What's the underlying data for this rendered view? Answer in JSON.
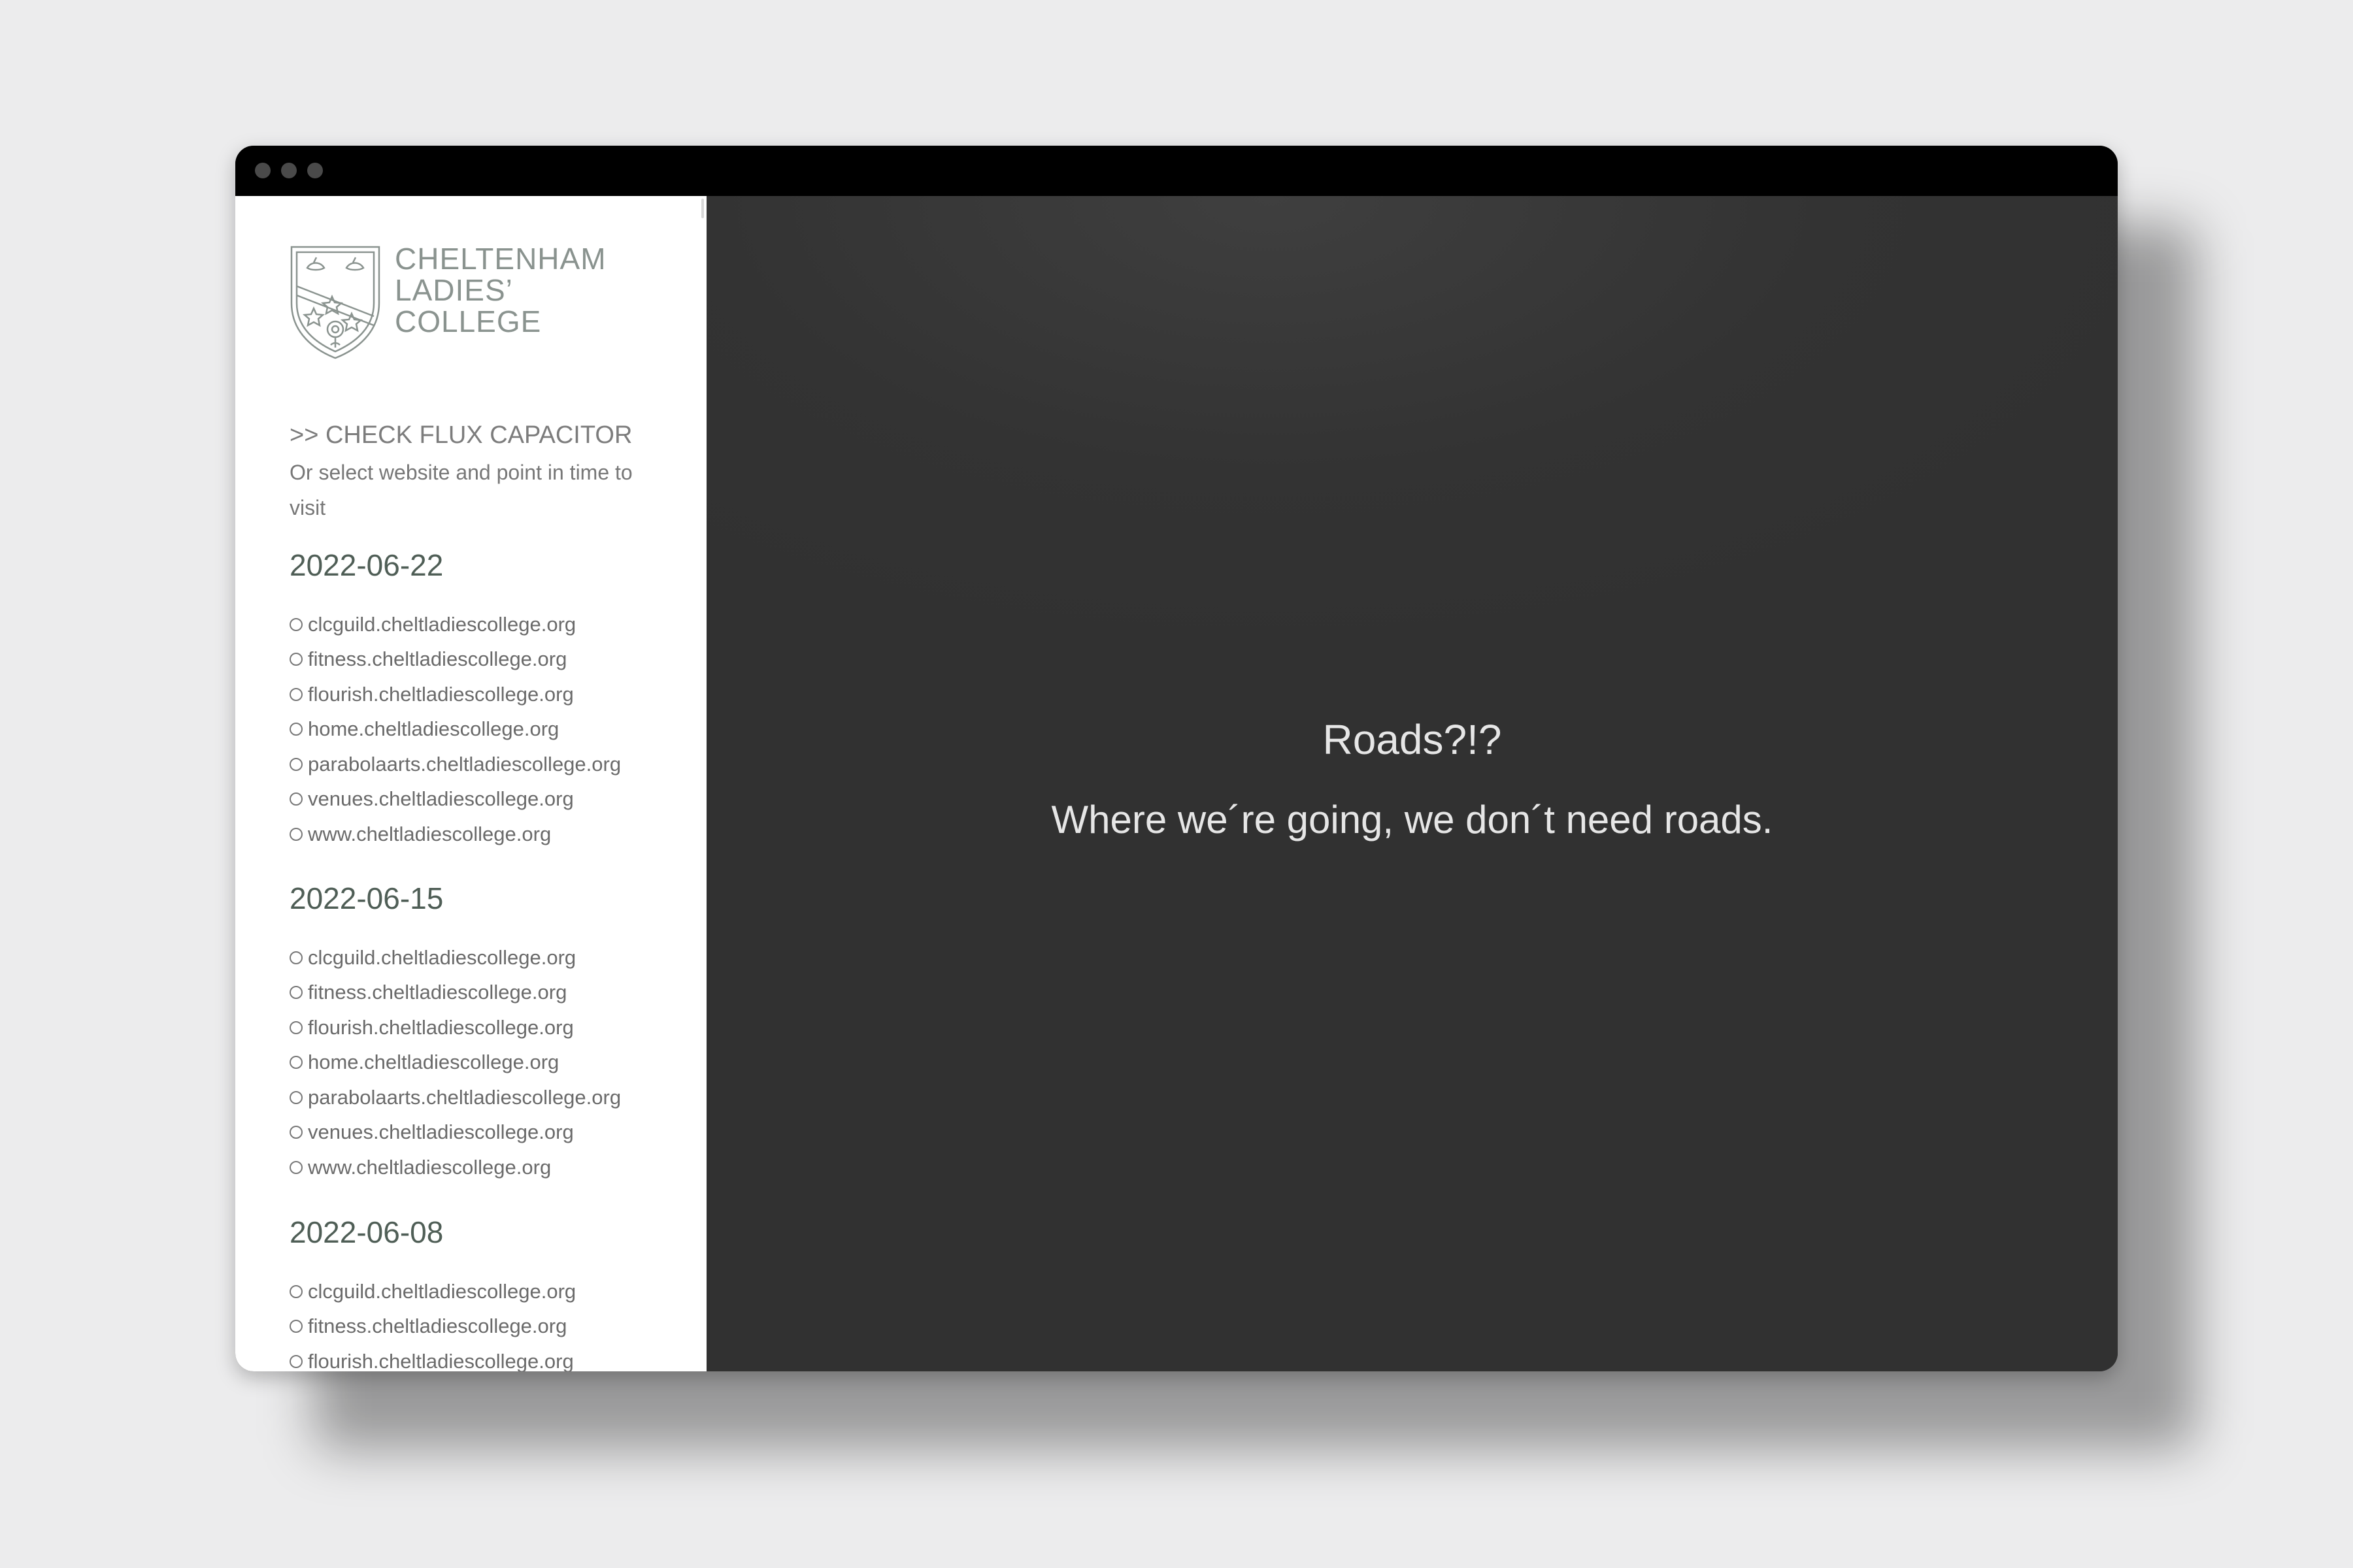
{
  "brand": {
    "name_lines": [
      "CHELTENHAM",
      "LADIES’",
      "COLLEGE"
    ],
    "crest_icon": "college-crest-icon",
    "color": "#8a938f"
  },
  "sidebar": {
    "flux_link": ">> CHECK FLUX CAPACITOR",
    "intro": "Or select website and point in time to visit",
    "dates": [
      {
        "date": "2022-06-22",
        "sites": [
          "clcguild.cheltladiescollege.org",
          "fitness.cheltladiescollege.org",
          "flourish.cheltladiescollege.org",
          "home.cheltladiescollege.org",
          "parabolaarts.cheltladiescollege.org",
          "venues.cheltladiescollege.org",
          "www.cheltladiescollege.org"
        ]
      },
      {
        "date": "2022-06-15",
        "sites": [
          "clcguild.cheltladiescollege.org",
          "fitness.cheltladiescollege.org",
          "flourish.cheltladiescollege.org",
          "home.cheltladiescollege.org",
          "parabolaarts.cheltladiescollege.org",
          "venues.cheltladiescollege.org",
          "www.cheltladiescollege.org"
        ]
      },
      {
        "date": "2022-06-08",
        "sites": [
          "clcguild.cheltladiescollege.org",
          "fitness.cheltladiescollege.org",
          "flourish.cheltladiescollege.org"
        ]
      }
    ]
  },
  "main": {
    "headline": "Roads?!?",
    "tagline": "Where we´re going, we don´t need roads."
  },
  "colors": {
    "titlebar": "#000000",
    "content_bg": "#333333",
    "heading": "#4f5e56"
  }
}
